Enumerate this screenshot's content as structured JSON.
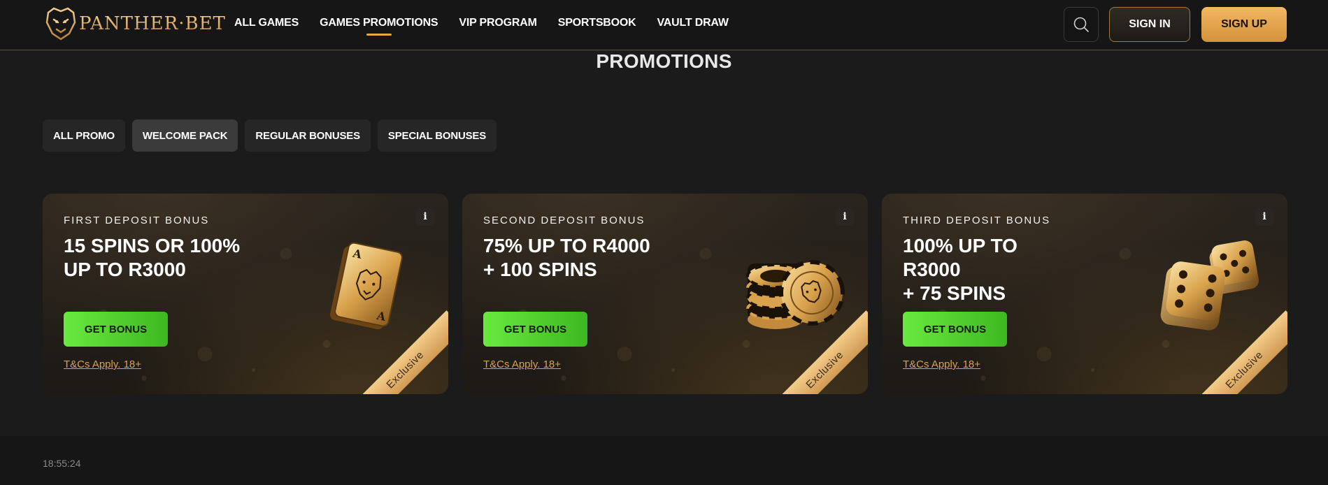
{
  "brand": {
    "name": "PANTHER·BET",
    "logo_icon": "panther-head-icon",
    "gold": "#e3a84e"
  },
  "nav": {
    "items": [
      {
        "label": "ALL GAMES",
        "active": false
      },
      {
        "label": "GAMES PROMOTIONS",
        "active": true
      },
      {
        "label": "VIP PROGRAM",
        "active": false
      },
      {
        "label": "SPORTSBOOK",
        "active": false
      },
      {
        "label": "VAULT DRAW",
        "active": false
      }
    ]
  },
  "header": {
    "search_icon": "search-icon",
    "signin_label": "SIGN IN",
    "signup_label": "SIGN UP"
  },
  "page": {
    "title": "PROMOTIONS"
  },
  "filters": {
    "tabs": [
      {
        "label": "ALL PROMO",
        "active": false
      },
      {
        "label": "WELCOME PACK",
        "active": true
      },
      {
        "label": "REGULAR BONUSES",
        "active": false
      },
      {
        "label": "SPECIAL BONUSES",
        "active": false
      }
    ]
  },
  "cards": [
    {
      "subtitle": "FIRST DEPOSIT BONUS",
      "title": "15 SPINS OR 100%\nUP TO R3000",
      "button": "GET BONUS",
      "terms": "T&Cs Apply. 18+",
      "ribbon": "Exclusive",
      "info": "i",
      "illustration": "golden-playing-cards-icon"
    },
    {
      "subtitle": "SECOND DEPOSIT BONUS",
      "title": "75% UP TO R4000\n+ 100 SPINS",
      "button": "GET BONUS",
      "terms": "T&Cs Apply. 18+",
      "ribbon": "Exclusive",
      "info": "i",
      "illustration": "golden-casino-chips-icon"
    },
    {
      "subtitle": "THIRD DEPOSIT BONUS",
      "title": "100% UP TO\nR3000\n+ 75 SPINS",
      "button": "GET BONUS",
      "terms": "T&Cs Apply. 18+",
      "ribbon": "Exclusive",
      "info": "i",
      "illustration": "golden-dice-icon"
    }
  ],
  "footer": {
    "time": "18:55:24"
  }
}
